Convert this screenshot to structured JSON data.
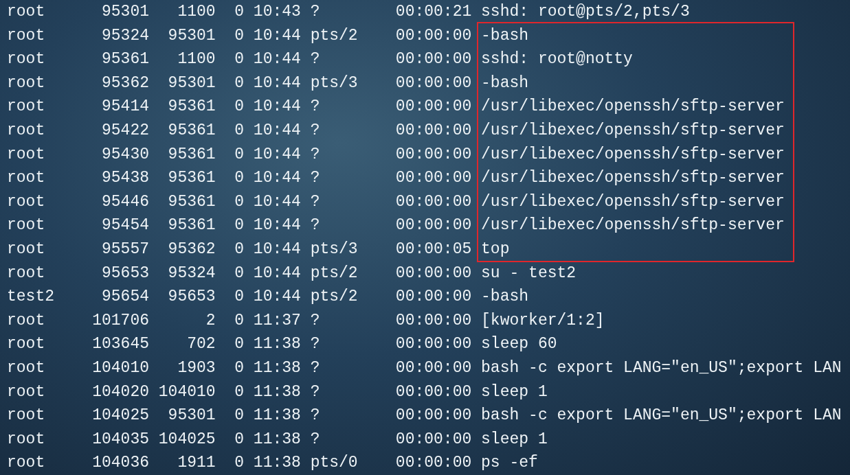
{
  "rows_above": [
    {
      "uid": "root",
      "pid": "95301",
      "ppid": "1100",
      "c": "0",
      "stime": "10:43",
      "tty": "?",
      "time": "00:00:21",
      "cmd": "sshd: root@pts/2,pts/3"
    }
  ],
  "highlighted_rows": [
    {
      "uid": "root",
      "pid": "95324",
      "ppid": "95301",
      "c": "0",
      "stime": "10:44",
      "tty": "pts/2",
      "time": "00:00:00",
      "cmd": "-bash"
    },
    {
      "uid": "root",
      "pid": "95361",
      "ppid": "1100",
      "c": "0",
      "stime": "10:44",
      "tty": "?",
      "time": "00:00:00",
      "cmd": "sshd: root@notty"
    },
    {
      "uid": "root",
      "pid": "95362",
      "ppid": "95301",
      "c": "0",
      "stime": "10:44",
      "tty": "pts/3",
      "time": "00:00:00",
      "cmd": "-bash"
    },
    {
      "uid": "root",
      "pid": "95414",
      "ppid": "95361",
      "c": "0",
      "stime": "10:44",
      "tty": "?",
      "time": "00:00:00",
      "cmd": "/usr/libexec/openssh/sftp-server"
    },
    {
      "uid": "root",
      "pid": "95422",
      "ppid": "95361",
      "c": "0",
      "stime": "10:44",
      "tty": "?",
      "time": "00:00:00",
      "cmd": "/usr/libexec/openssh/sftp-server"
    },
    {
      "uid": "root",
      "pid": "95430",
      "ppid": "95361",
      "c": "0",
      "stime": "10:44",
      "tty": "?",
      "time": "00:00:00",
      "cmd": "/usr/libexec/openssh/sftp-server"
    },
    {
      "uid": "root",
      "pid": "95438",
      "ppid": "95361",
      "c": "0",
      "stime": "10:44",
      "tty": "?",
      "time": "00:00:00",
      "cmd": "/usr/libexec/openssh/sftp-server"
    },
    {
      "uid": "root",
      "pid": "95446",
      "ppid": "95361",
      "c": "0",
      "stime": "10:44",
      "tty": "?",
      "time": "00:00:00",
      "cmd": "/usr/libexec/openssh/sftp-server"
    },
    {
      "uid": "root",
      "pid": "95454",
      "ppid": "95361",
      "c": "0",
      "stime": "10:44",
      "tty": "?",
      "time": "00:00:00",
      "cmd": "/usr/libexec/openssh/sftp-server"
    },
    {
      "uid": "root",
      "pid": "95557",
      "ppid": "95362",
      "c": "0",
      "stime": "10:44",
      "tty": "pts/3",
      "time": "00:00:05",
      "cmd": "top"
    }
  ],
  "rows_below": [
    {
      "uid": "root",
      "pid": "95653",
      "ppid": "95324",
      "c": "0",
      "stime": "10:44",
      "tty": "pts/2",
      "time": "00:00:00",
      "cmd": "su - test2"
    },
    {
      "uid": "test2",
      "pid": "95654",
      "ppid": "95653",
      "c": "0",
      "stime": "10:44",
      "tty": "pts/2",
      "time": "00:00:00",
      "cmd": "-bash"
    },
    {
      "uid": "root",
      "pid": "101706",
      "ppid": "2",
      "c": "0",
      "stime": "11:37",
      "tty": "?",
      "time": "00:00:00",
      "cmd": "[kworker/1:2]"
    },
    {
      "uid": "root",
      "pid": "103645",
      "ppid": "702",
      "c": "0",
      "stime": "11:38",
      "tty": "?",
      "time": "00:00:00",
      "cmd": "sleep 60"
    },
    {
      "uid": "root",
      "pid": "104010",
      "ppid": "1903",
      "c": "0",
      "stime": "11:38",
      "tty": "?",
      "time": "00:00:00",
      "cmd": "bash -c export LANG=\"en_US\";export LAN"
    },
    {
      "uid": "root",
      "pid": "104020",
      "ppid": "104010",
      "c": "0",
      "stime": "11:38",
      "tty": "?",
      "time": "00:00:00",
      "cmd": "sleep 1"
    },
    {
      "uid": "root",
      "pid": "104025",
      "ppid": "95301",
      "c": "0",
      "stime": "11:38",
      "tty": "?",
      "time": "00:00:00",
      "cmd": "bash -c export LANG=\"en_US\";export LAN"
    },
    {
      "uid": "root",
      "pid": "104035",
      "ppid": "104025",
      "c": "0",
      "stime": "11:38",
      "tty": "?",
      "time": "00:00:00",
      "cmd": "sleep 1"
    },
    {
      "uid": "root",
      "pid": "104036",
      "ppid": "1911",
      "c": "0",
      "stime": "11:38",
      "tty": "pts/0",
      "time": "00:00:00",
      "cmd": "ps -ef"
    }
  ]
}
